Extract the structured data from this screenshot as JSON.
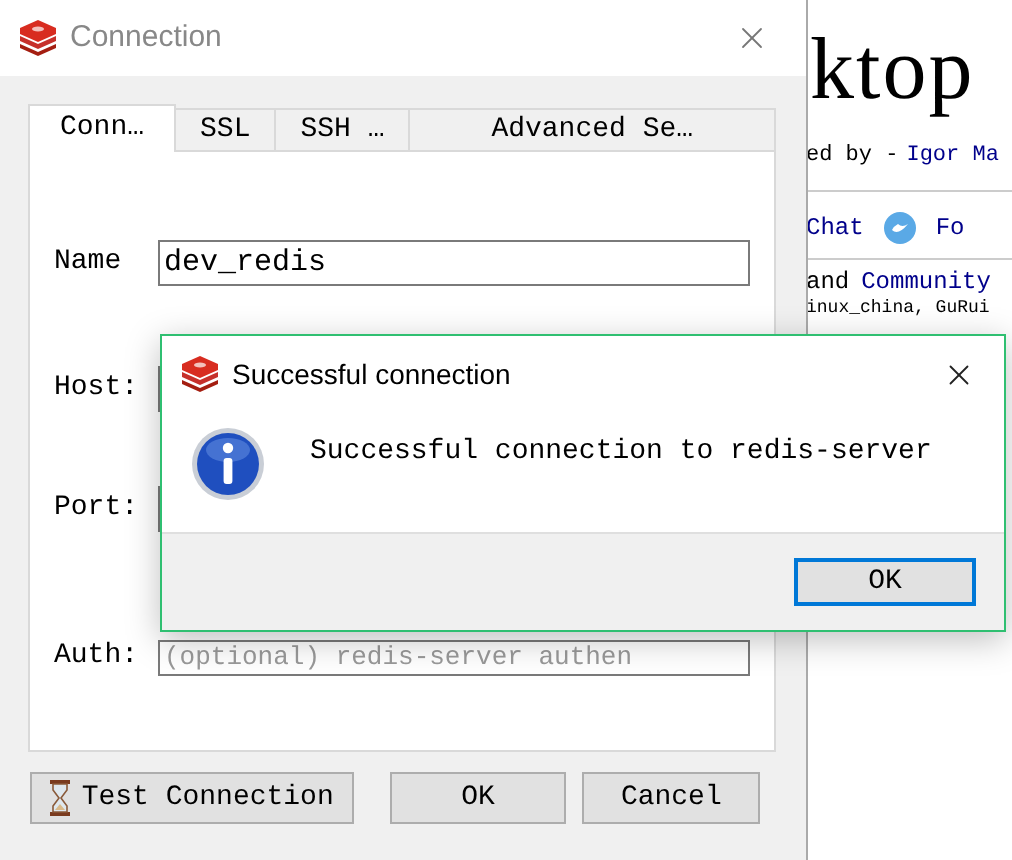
{
  "background_page": {
    "heading": "ktop",
    "byline_prefix": "ed by -",
    "author": "Igor Ma",
    "links": [
      {
        "label": "Chat",
        "kind": "text"
      },
      {
        "label": "Fo",
        "kind": "bird"
      }
    ],
    "line_1_prefix": "and",
    "line_1_link": "Community",
    "line_2": "inux_china, GuRui"
  },
  "window": {
    "title": "Connection"
  },
  "tabs": [
    {
      "label": "Conn…",
      "selected": true
    },
    {
      "label": "SSL",
      "selected": false
    },
    {
      "label": "SSH …",
      "selected": false
    },
    {
      "label": "Advanced Se…",
      "selected": false
    }
  ],
  "form": {
    "name": {
      "label": "Name",
      "value": "dev_redis"
    },
    "host": {
      "label": "Host:"
    },
    "port": {
      "label": "Port:"
    },
    "auth": {
      "label": "Auth:",
      "placeholder": "(optional) redis-server authen"
    }
  },
  "buttons": [
    {
      "label": "Test Connection",
      "kind": "test"
    },
    {
      "label": "OK",
      "kind": "plain"
    },
    {
      "label": "Cancel",
      "kind": "plain"
    }
  ],
  "dialog": {
    "title": "Successful connection",
    "message": "Successful connection to redis-server",
    "button": "OK"
  }
}
